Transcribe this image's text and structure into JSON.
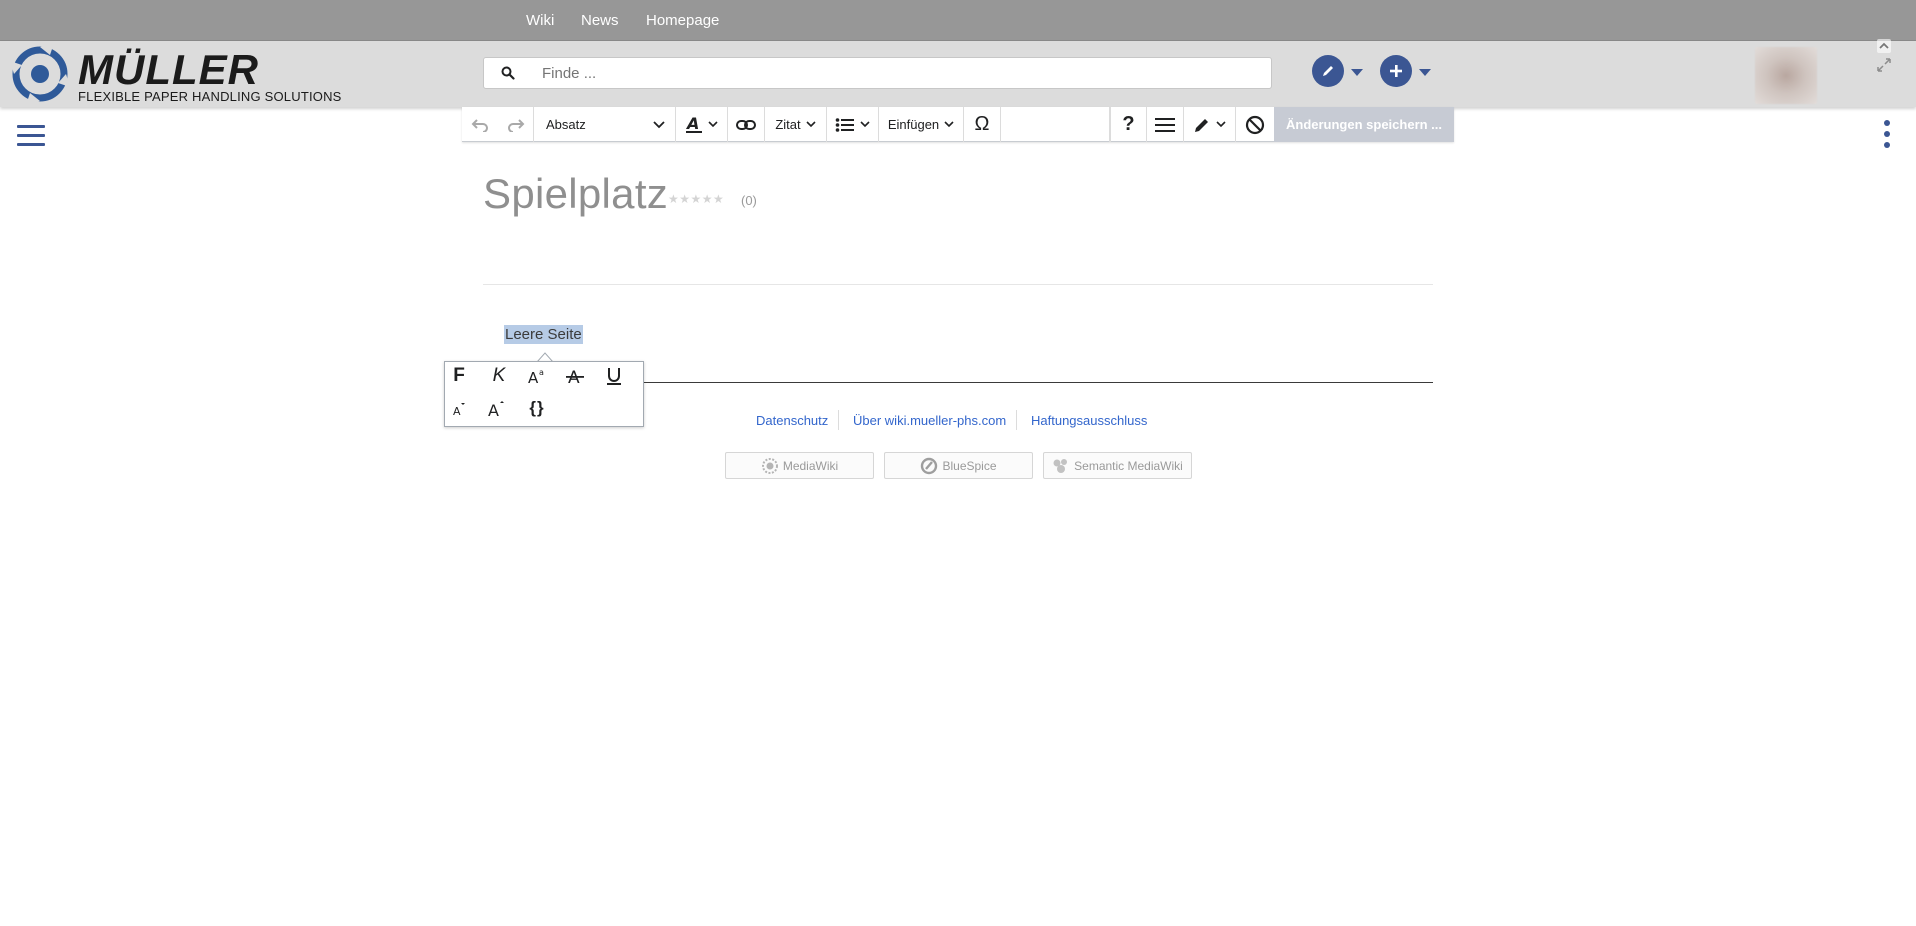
{
  "topnav": {
    "items": [
      "Wiki",
      "News",
      "Homepage"
    ]
  },
  "header": {
    "logo_title": "MÜLLER",
    "logo_subtitle": "FLEXIBLE PAPER HANDLING SOLUTIONS",
    "search_placeholder": "Finde ..."
  },
  "toolbar": {
    "paragraph": "Absatz",
    "quote": "Zitat",
    "insert": "Einfügen",
    "special_char": "Ω",
    "help": "?",
    "save": "Änderungen speichern ..."
  },
  "content": {
    "title": "Spielplatz",
    "stars": "★★★★★",
    "rating_count": "(0)",
    "body_text": "Leere Seite"
  },
  "popup": {
    "bold": "F",
    "italic": "K",
    "code": "{}"
  },
  "footer": {
    "links": [
      "Datenschutz",
      "Über wiki.mueller-phs.com",
      "Haftungsausschluss"
    ],
    "badges": [
      "MediaWiki",
      "BlueSpice",
      "Semantic MediaWiki"
    ]
  },
  "colors": {
    "accent": "#3b5693",
    "topnav_bg": "#979797",
    "header_bg": "#dcdcdc",
    "save_disabled": "#c7cbd4",
    "link": "#3366cc",
    "selection": "#b6cbe6"
  }
}
